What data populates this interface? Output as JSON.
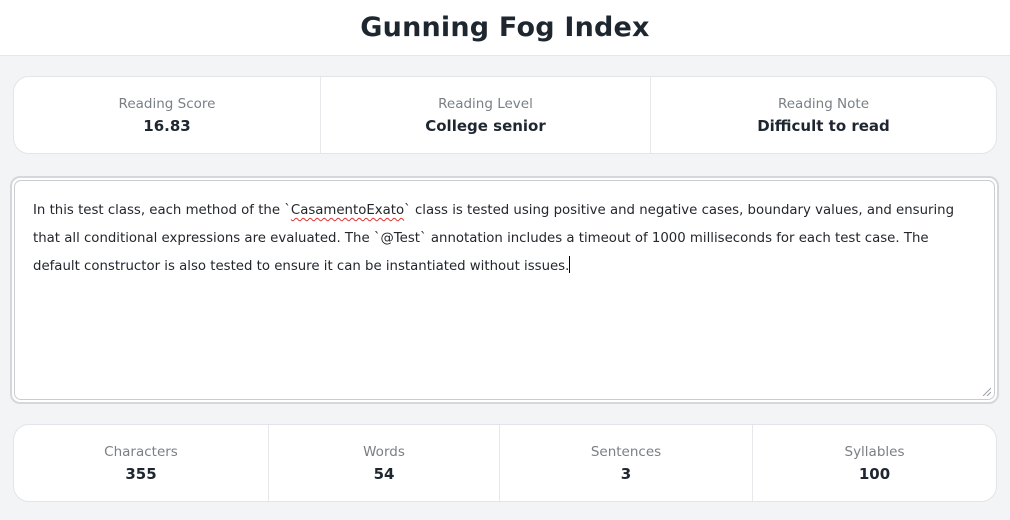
{
  "header": {
    "title": "Gunning Fog Index"
  },
  "reading": {
    "score_label": "Reading Score",
    "score_value": "16.83",
    "level_label": "Reading Level",
    "level_value": "College senior",
    "note_label": "Reading Note",
    "note_value": "Difficult to read"
  },
  "editor": {
    "part1": "In this test class, each method of the `",
    "misspelled": "CasamentoExato",
    "part2": "` class is tested using positive and negative cases, boundary values, and ensuring that all conditional expressions are evaluated. The `@Test` annotation includes a timeout of 1000 milliseconds for each test case. The default constructor is also tested to ensure it can be instantiated without issues."
  },
  "stats": {
    "characters_label": "Characters",
    "characters_value": "355",
    "words_label": "Words",
    "words_value": "54",
    "sentences_label": "Sentences",
    "sentences_value": "3",
    "syllables_label": "Syllables",
    "syllables_value": "100"
  }
}
